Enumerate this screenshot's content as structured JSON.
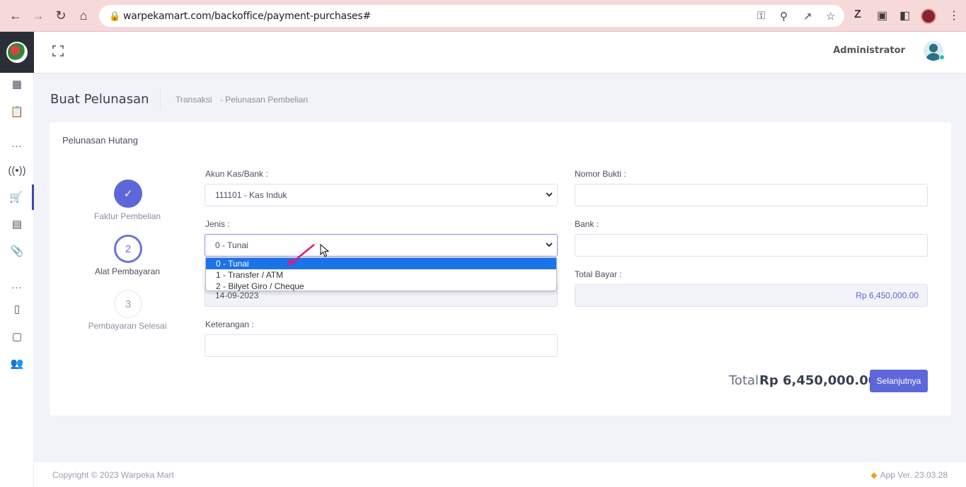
{
  "browser": {
    "url": "warpekamart.com/backoffice/payment-purchases#"
  },
  "header": {
    "user_name": "Administrator"
  },
  "subheader": {
    "title": "Buat Pelunasan",
    "breadcrumb": [
      "Transaksi",
      "- Pelunasan Pembelian"
    ]
  },
  "card": {
    "title": "Pelunasan Hutang"
  },
  "steps": [
    {
      "number": "",
      "label": "Faktur Pembelian",
      "state": "done"
    },
    {
      "number": "2",
      "label": "Alat Pembayaran",
      "state": "current"
    },
    {
      "number": "3",
      "label": "Pembayaran Selesai",
      "state": "todo"
    }
  ],
  "form": {
    "akun_label": "Akun Kas/Bank :",
    "akun_value": "111101 - Kas Induk",
    "jenis_label": "Jenis :",
    "jenis_value": "0 - Tunai",
    "jenis_options": [
      "0 - Tunai",
      "1 - Transfer / ATM",
      "2 - Bilyet Giro / Cheque"
    ],
    "tanggal_value": "14-09-2023",
    "keterangan_label": "Keterangan :",
    "keterangan_value": "",
    "nomor_label": "Nomor Bukti :",
    "nomor_value": "",
    "bank_label": "Bank :",
    "bank_value": "",
    "total_bayar_label": "Total Bayar :",
    "total_bayar_value": "Rp 6,450,000.00"
  },
  "summary": {
    "total_label": "Total",
    "total_value": "Rp 6,450,000.00",
    "next_button": "Selanjutnya"
  },
  "footer": {
    "copyright": "Copyright © 2023 Warpeka Mart",
    "version": "App Ver. 23.03.28"
  },
  "colors": {
    "accent": "#5d67d9",
    "chrome": "#f6d9d9",
    "selected_option": "#1a73e8",
    "annotation_arrow": "#e0197d"
  }
}
